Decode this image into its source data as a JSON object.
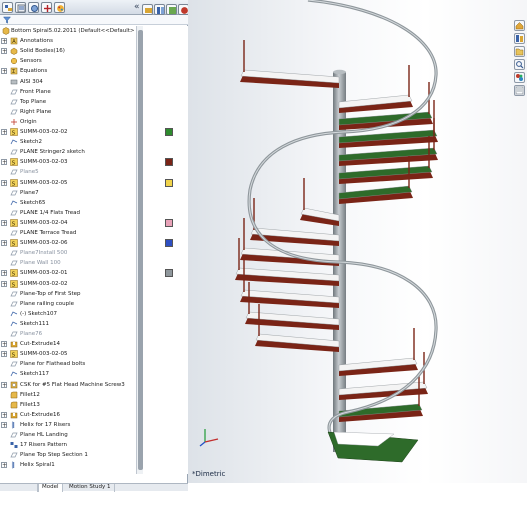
{
  "feature_tree": {
    "root_label": "Bottom Spiral5.02.2011 (Default<<Default> D",
    "items": [
      {
        "label": "Annotations",
        "icon": "annotations-icon",
        "expandable": true
      },
      {
        "label": "Solid Bodies(16)",
        "icon": "solid-bodies-icon",
        "expandable": true
      },
      {
        "label": "Sensors",
        "icon": "sensors-icon",
        "expandable": false
      },
      {
        "label": "Equations",
        "icon": "equations-icon",
        "expandable": true
      },
      {
        "label": "AISI 304",
        "icon": "material-icon",
        "expandable": false
      },
      {
        "label": "Front Plane",
        "icon": "plane-icon",
        "expandable": false
      },
      {
        "label": "Top Plane",
        "icon": "plane-icon",
        "expandable": false
      },
      {
        "label": "Right Plane",
        "icon": "plane-icon",
        "expandable": false
      },
      {
        "label": "Origin",
        "icon": "origin-icon",
        "expandable": false
      },
      {
        "label": "SUMM-003-02-02",
        "icon": "part-icon",
        "expandable": true
      },
      {
        "label": "Sketch2",
        "icon": "sketch-icon",
        "expandable": false
      },
      {
        "label": "PLANE Stringer2 sketch",
        "icon": "plane-icon",
        "expandable": false
      },
      {
        "label": "SUMM-003-02-03",
        "icon": "part-icon",
        "expandable": true
      },
      {
        "label": "Plane5",
        "icon": "plane-icon",
        "expandable": false,
        "faint": true
      },
      {
        "label": "SUMM-003-02-05",
        "icon": "part-icon",
        "expandable": true
      },
      {
        "label": "Plane7",
        "icon": "plane-icon",
        "expandable": false
      },
      {
        "label": "Sketch65",
        "icon": "sketch-icon",
        "expandable": false
      },
      {
        "label": "PLANE 1/4 Flats Tread",
        "icon": "plane-icon",
        "expandable": false
      },
      {
        "label": "SUMM-003-02-04",
        "icon": "part-icon",
        "expandable": true
      },
      {
        "label": "PLANE Terrace Tread",
        "icon": "plane-icon",
        "expandable": false
      },
      {
        "label": "SUMM-003-02-06",
        "icon": "part-icon",
        "expandable": true
      },
      {
        "label": "Plane7Install 500",
        "icon": "plane-icon",
        "expandable": false,
        "faint": true
      },
      {
        "label": "Plane Wall 100",
        "icon": "plane-icon",
        "expandable": false,
        "faint": true
      },
      {
        "label": "SUMM-003-02-01",
        "icon": "part-icon",
        "expandable": true
      },
      {
        "label": "SUMM-003-02-02",
        "icon": "part-icon",
        "expandable": true
      },
      {
        "label": "Plane-Top of First Step",
        "icon": "plane-icon",
        "expandable": false
      },
      {
        "label": "Plane railing couple",
        "icon": "plane-icon",
        "expandable": false
      },
      {
        "label": "(-) Sketch107",
        "icon": "sketch-icon",
        "expandable": false
      },
      {
        "label": "Sketch111",
        "icon": "sketch-icon",
        "expandable": false
      },
      {
        "label": "Plane76",
        "icon": "plane-icon",
        "expandable": false,
        "faint": true
      },
      {
        "label": "Cut-Extrude14",
        "icon": "cut-extrude-icon",
        "expandable": true
      },
      {
        "label": "SUMM-003-02-05",
        "icon": "part-icon",
        "expandable": true
      },
      {
        "label": "Plane for Flathead bolts",
        "icon": "plane-icon",
        "expandable": false
      },
      {
        "label": "Sketch117",
        "icon": "sketch-icon",
        "expandable": false
      },
      {
        "label": "CSK for #5 Flat Head Machine Screw3",
        "icon": "hole-icon",
        "expandable": true
      },
      {
        "label": "Fillet12",
        "icon": "fillet-icon",
        "expandable": false
      },
      {
        "label": "Fillet13",
        "icon": "fillet-icon",
        "expandable": false
      },
      {
        "label": "Cut-Extrude16",
        "icon": "cut-extrude-icon",
        "expandable": true
      },
      {
        "label": "Helix for 17 Risers",
        "icon": "helix-icon",
        "expandable": true
      },
      {
        "label": "Plane HL Landing",
        "icon": "plane-icon",
        "expandable": false
      },
      {
        "label": "17 Risers Pattern",
        "icon": "pattern-icon",
        "expandable": false
      },
      {
        "label": "Plane Top Step Section 1",
        "icon": "plane-icon",
        "expandable": false
      },
      {
        "label": "Helix Spiral1",
        "icon": "helix-icon",
        "expandable": true
      }
    ]
  },
  "viewport": {
    "view_label": "*Dimetric"
  },
  "bottom_tabs": [
    {
      "label": "",
      "active": false
    },
    {
      "label": "Model",
      "active": true
    },
    {
      "label": "Motion Study 1",
      "active": false
    }
  ],
  "colors": {
    "tread": "#f4f4f4",
    "stringer": "#7a2416",
    "tread_green": "#2e6b2a",
    "pole": "#9aa2a6",
    "rail": "#a6adb2",
    "panel_border": "#9aa6b4"
  }
}
